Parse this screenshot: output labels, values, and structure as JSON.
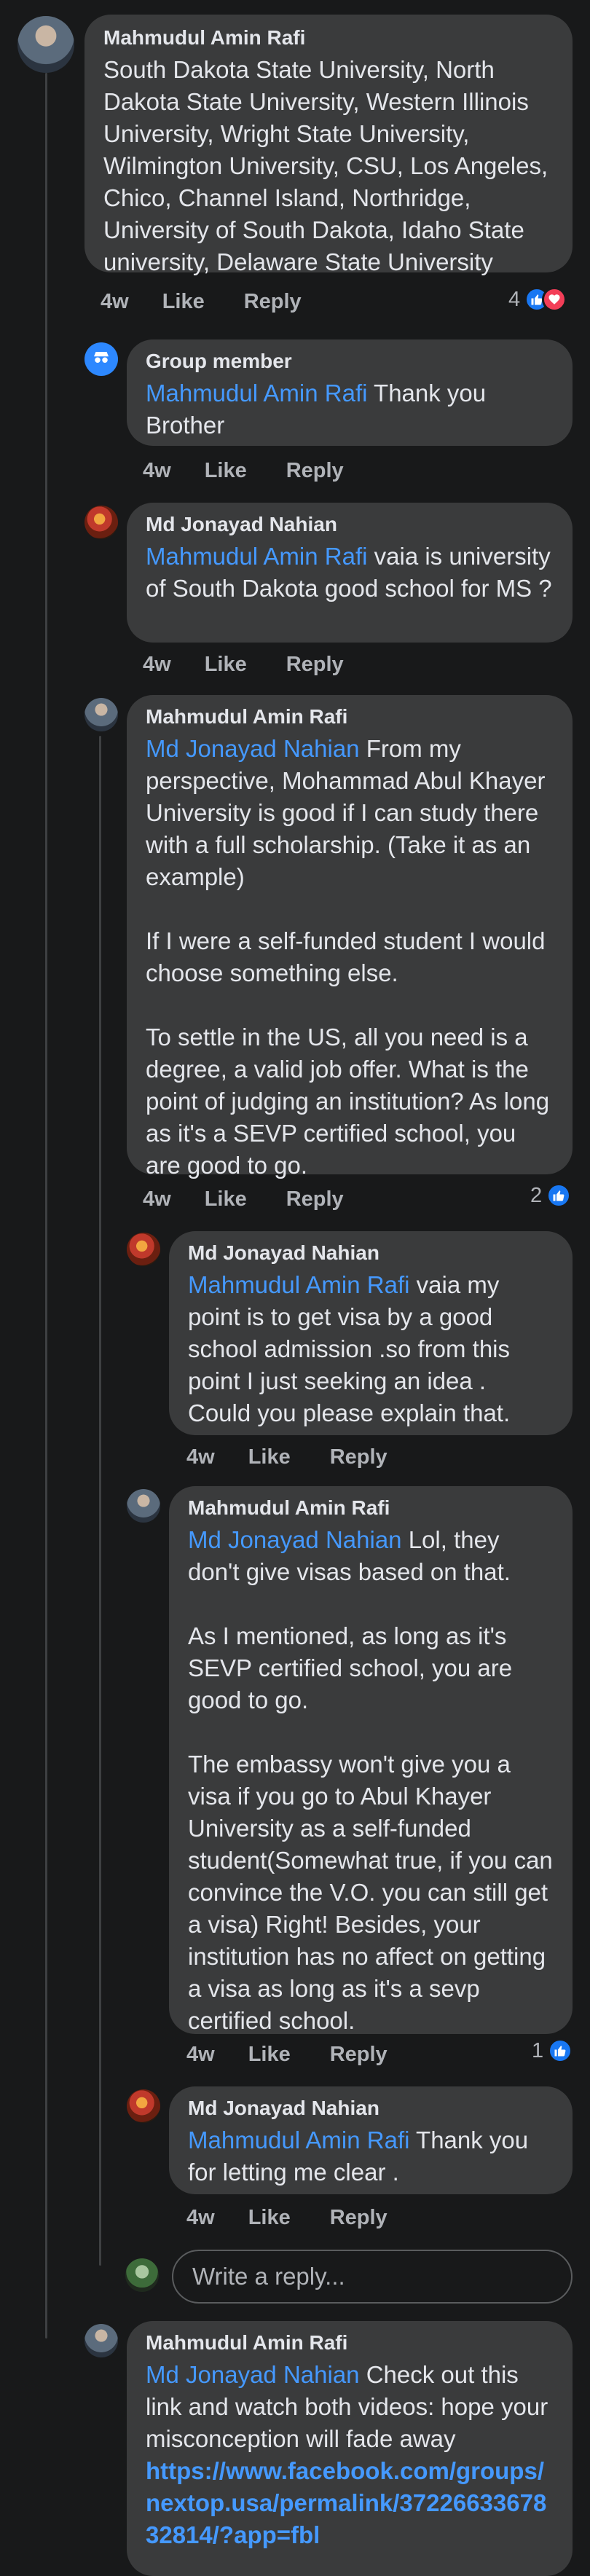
{
  "comments": [
    {
      "author": "Mahmudul Amin Rafi",
      "paragraphs": [
        "South Dakota State University, North Dakota State University, Western Illinois University, Wright State University, Wilmington University, CSU, Los Angeles, Chico, Channel Island, Northridge, University of South Dakota, Idaho State university, Delaware State University"
      ],
      "time": "4w",
      "like": "Like",
      "reply": "Reply",
      "reaction_count": "4"
    },
    {
      "author": "Group member",
      "mention": "Mahmudul Amin Rafi",
      "text": " Thank you Brother",
      "time": "4w",
      "like": "Like",
      "reply": "Reply"
    },
    {
      "author": "Md Jonayad Nahian",
      "mention": "Mahmudul Amin Rafi",
      "text": " vaia is university of South Dakota good school for MS ?",
      "time": "4w",
      "like": "Like",
      "reply": "Reply"
    },
    {
      "author": "Mahmudul Amin Rafi",
      "mention": "Md Jonayad Nahian",
      "text": " From my perspective, Mohammad Abul Khayer University is good if I can study there with a full scholarship. (Take it as an example)",
      "p2": "If I  were a self-funded student I would choose something else.",
      "p3": "To settle in the US, all you need is a degree, a valid job offer. What is the point of judging an institution? As long as it's a SEVP certified school, you are good to go.",
      "time": "4w",
      "like": "Like",
      "reply": "Reply",
      "reaction_count": "2"
    },
    {
      "author": "Md Jonayad Nahian",
      "mention": "Mahmudul Amin Rafi",
      "text": "  vaia my point is to get visa by a good school admission .so from this point I just seeking an idea . Could you please explain that.",
      "time": "4w",
      "like": "Like",
      "reply": "Reply"
    },
    {
      "author": "Mahmudul Amin Rafi",
      "mention": "Md Jonayad Nahian",
      "text": " Lol, they don't give visas based on that.",
      "p2": "As I mentioned, as long as it's SEVP certified school, you are good to go.",
      "p3": "The embassy won't give you a visa if you go to Abul Khayer University as a self-funded student(Somewhat true, if you can convince the V.O. you can still get a visa) Right! Besides, your institution has no affect on getting a visa as long as it's a sevp certified school.",
      "time": "4w",
      "like": "Like",
      "reply": "Reply",
      "reaction_count": "1"
    },
    {
      "author": "Md Jonayad Nahian",
      "mention": "Mahmudul Amin Rafi",
      "text": "  Thank you for letting me clear .",
      "time": "4w",
      "like": "Like",
      "reply": "Reply"
    },
    {
      "author": "Mahmudul Amin Rafi",
      "mention": "Md Jonayad Nahian",
      "text": " Check out this link and watch both videos: hope your misconception will fade away",
      "link": "https://www.facebook.com/groups/nextop.usa/permalink/3722663367832814/?app=fbl"
    }
  ],
  "reply_box": {
    "placeholder": "Write a reply..."
  },
  "colors": {
    "bg": "#18191a",
    "bubble": "#3a3b3c",
    "mention": "#4599ff",
    "like": "#1877f2",
    "love": "#f33e58"
  },
  "icons": {
    "group_member": "anonymous-user-icon",
    "like": "thumbs-up-icon",
    "love": "heart-icon"
  }
}
